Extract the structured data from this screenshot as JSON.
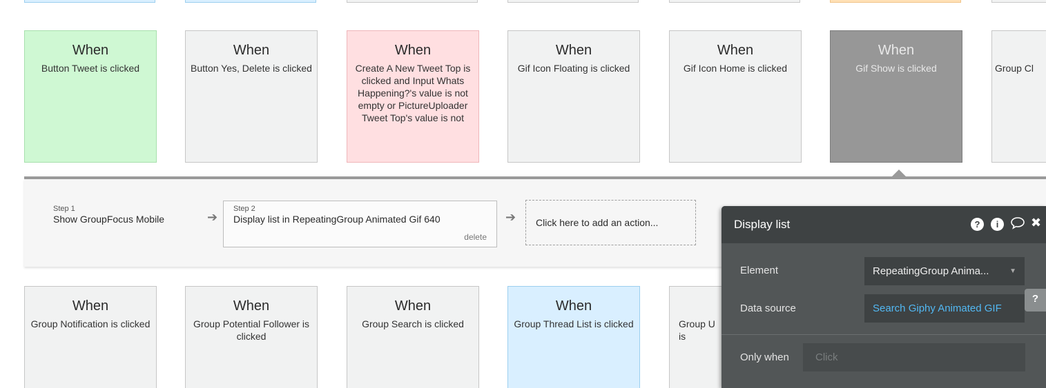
{
  "cards_row1": [
    {
      "when": "When",
      "desc": "Button Tweet is clicked"
    },
    {
      "when": "When",
      "desc": "Button Yes, Delete is clicked"
    },
    {
      "when": "When",
      "desc": "Create A New Tweet Top is clicked and Input Whats Happening?'s value is not empty or PictureUploader Tweet Top's value is not"
    },
    {
      "when": "When",
      "desc": "Gif Icon Floating is clicked"
    },
    {
      "when": "When",
      "desc": "Gif Icon Home is clicked"
    },
    {
      "when": "When",
      "desc": "Gif Show is clicked"
    },
    {
      "when": "W",
      "desc": "Group Cl"
    }
  ],
  "cards_row2": [
    {
      "when": "When",
      "desc": "Group Notification is clicked"
    },
    {
      "when": "When",
      "desc": "Group Potential Follower is clicked"
    },
    {
      "when": "When",
      "desc": "Group Search is clicked"
    },
    {
      "when": "When",
      "desc": "Group Thread List is clicked"
    },
    {
      "when": "W",
      "desc": "Group U is"
    }
  ],
  "workflow": {
    "step1": {
      "number": "Step 1",
      "title": "Show GroupFocus Mobile"
    },
    "step2": {
      "number": "Step 2",
      "title": "Display list in RepeatingGroup Animated Gif 640",
      "delete": "delete"
    },
    "add_action": "Click here to add an action..."
  },
  "property_editor": {
    "title": "Display list",
    "element_label": "Element",
    "element_value": "RepeatingGroup Anima...",
    "data_source_label": "Data source",
    "data_source_value": "Search Giphy Animated GIF",
    "only_when_label": "Only when",
    "only_when_placeholder": "Click",
    "header_icons": [
      "question-icon",
      "info-icon",
      "comment-icon",
      "close-icon"
    ]
  },
  "help_tab": "?",
  "colors": {
    "green_card": "#cff8d3",
    "pink_card": "#ffdfe1",
    "dark_card": "#979797",
    "blue_card": "#d9efff",
    "data_source_link": "#52b8f3",
    "editor_bg": "#525657"
  }
}
